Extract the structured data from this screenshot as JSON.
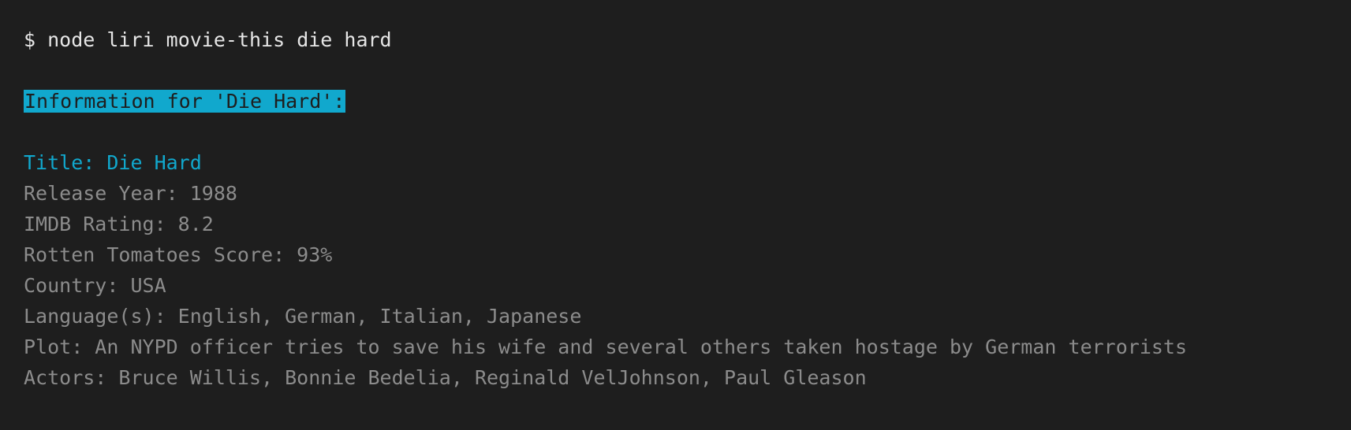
{
  "terminal": {
    "prompt_symbol": "$",
    "command": "node liri movie-this die hard",
    "header": "Information for 'Die Hard':",
    "title_line": "Title: Die Hard",
    "details": [
      "Release Year: 1988",
      "IMDB Rating: 8.2",
      "Rotten Tomatoes Score: 93%",
      "Country: USA",
      "Language(s): English, German, Italian, Japanese",
      "Plot: An NYPD officer tries to save his wife and several others taken hostage by German terrorists",
      "Actors: Bruce Willis, Bonnie Bedelia, Reginald VelJohnson, Paul Gleason"
    ]
  }
}
